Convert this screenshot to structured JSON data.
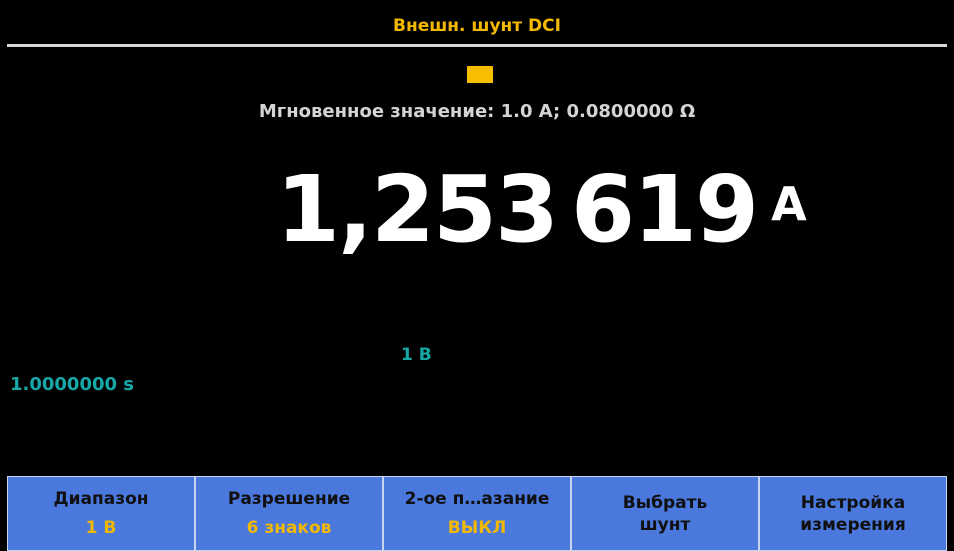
{
  "title": "Внешн. шунт DCI",
  "colors": {
    "title_text": "#f3b800",
    "indicator": "#f9bd00",
    "secondary_text": "#16a8a8",
    "softkey_bg": "#4a78dd",
    "softkey_value": "#f3b800"
  },
  "instant_value": "Мгновенное значение: 1.0 A; 0.0800000 Ω",
  "reading": {
    "main": "1,253",
    "rest": "619",
    "unit": "A"
  },
  "range_label": "1 В",
  "aperture": "1.0000000 s",
  "softkeys": [
    {
      "top": "Диапазон",
      "bottom": "1 В"
    },
    {
      "top": "Разрешение",
      "bottom": "6 знаков"
    },
    {
      "top": "2-ое п…азание",
      "bottom": "ВЫКЛ"
    },
    {
      "line1": "Выбрать",
      "line2": "шунт"
    },
    {
      "line1": "Настройка",
      "line2": "измерения"
    }
  ]
}
